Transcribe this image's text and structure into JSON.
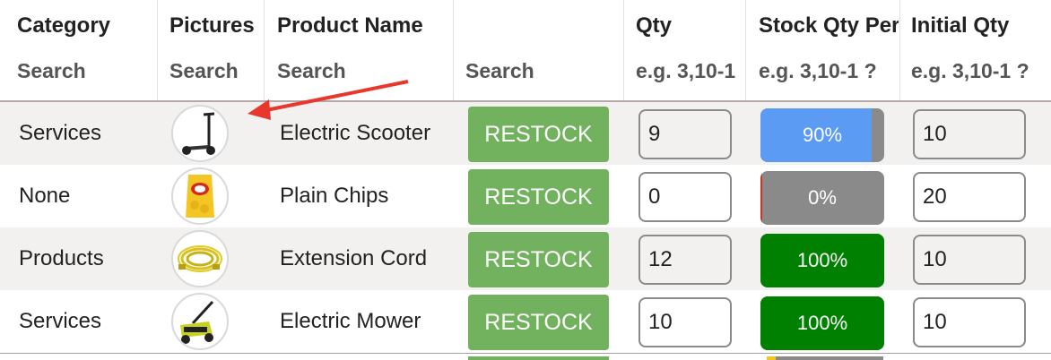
{
  "columns": [
    {
      "title": "Category",
      "search": "Search"
    },
    {
      "title": "Pictures",
      "search": "Search"
    },
    {
      "title": "Product Name",
      "search": "Search"
    },
    {
      "title": "",
      "search": "Search"
    },
    {
      "title": "Qty",
      "search": "e.g. 3,10-1 ?"
    },
    {
      "title": "Stock Qty Percent",
      "search": "e.g. 3,10-1 ?"
    },
    {
      "title": "Initial Qty",
      "search": "e.g. 3,10-1 ?"
    }
  ],
  "colors": {
    "restock": "#72b25f",
    "bar_track": "#8a8a8a",
    "bar_blue": "#5b9bf3",
    "bar_green": "#008000",
    "arrow": "#e8382e"
  },
  "rows": [
    {
      "category": "Services",
      "picture": "scooter-icon",
      "product": "Electric Scooter",
      "action": "RESTOCK",
      "qty": "9",
      "stock_percent": 0.9,
      "stock_label": "90%",
      "bar_color": "#5b9bf3",
      "initial_qty": "10"
    },
    {
      "category": "None",
      "picture": "chips-icon",
      "product": "Plain Chips",
      "action": "RESTOCK",
      "qty": "0",
      "stock_percent": 0,
      "stock_label": "0%",
      "bar_color": "#8a8a8a",
      "initial_qty": "20"
    },
    {
      "category": "Products",
      "picture": "extension-cord-icon",
      "product": "Extension Cord",
      "action": "RESTOCK",
      "qty": "12",
      "stock_percent": 1.0,
      "stock_label": "100%",
      "bar_color": "#008000",
      "initial_qty": "10"
    },
    {
      "category": "Services",
      "picture": "lawn-mower-icon",
      "product": "Electric Mower",
      "action": "RESTOCK",
      "qty": "10",
      "stock_percent": 1.0,
      "stock_label": "100%",
      "bar_color": "#008000",
      "initial_qty": "10"
    }
  ]
}
